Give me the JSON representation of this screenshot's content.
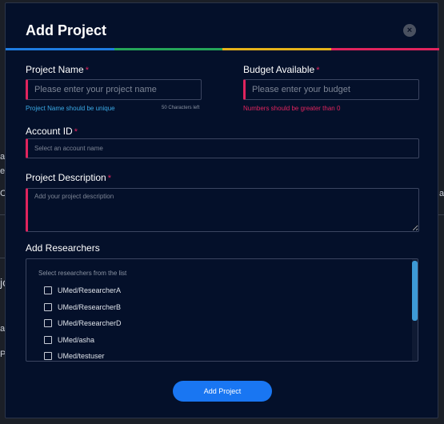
{
  "background": {
    "fragments": [
      "a",
      "e",
      "C",
      "a",
      "jc",
      "a",
      "P"
    ]
  },
  "modal": {
    "title": "Add Project",
    "close_label": "×",
    "accent_colors": [
      "#1e7be0",
      "#25a559",
      "#e5b21a",
      "#e0245e"
    ]
  },
  "form": {
    "project_name": {
      "label": "Project Name",
      "required_marker": "*",
      "placeholder": "Please enter your project name",
      "value": "",
      "hint": "Project Name should be unique",
      "char_hint": "50 Characters left"
    },
    "budget": {
      "label": "Budget Available",
      "required_marker": "*",
      "placeholder": "Please enter your budget",
      "value": "",
      "hint": "Numbers should be greater than 0"
    },
    "account_id": {
      "label": "Account ID",
      "required_marker": "*",
      "placeholder": "Select an account name",
      "value": ""
    },
    "description": {
      "label": "Project Description",
      "required_marker": "*",
      "placeholder": "Add your project description",
      "value": ""
    },
    "researchers": {
      "label": "Add Researchers",
      "hint": "Select researchers from the list",
      "items": [
        {
          "name": "UMed/ResearcherA",
          "checked": false
        },
        {
          "name": "UMed/ResearcherB",
          "checked": false
        },
        {
          "name": "UMed/ResearcherD",
          "checked": false
        },
        {
          "name": "UMed/asha",
          "checked": false
        },
        {
          "name": "UMed/testuser",
          "checked": false
        }
      ]
    },
    "submit_label": "Add Project"
  }
}
